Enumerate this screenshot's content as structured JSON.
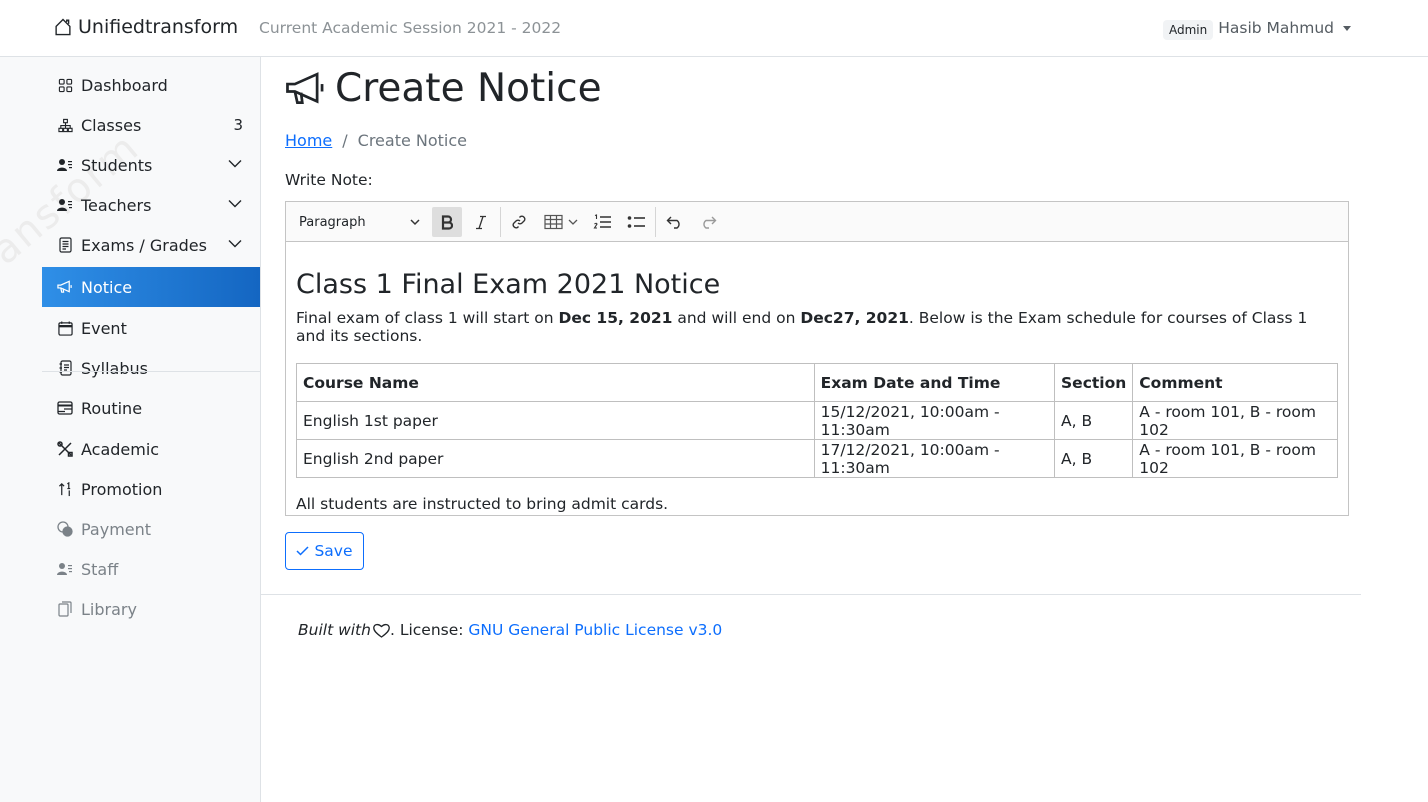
{
  "navbar": {
    "brand": "Unifiedtransform",
    "session": "Current Academic Session 2021 - 2022",
    "role_badge": "Admin",
    "user_name": "Hasib Mahmud"
  },
  "sidebar": {
    "watermark": "ransform",
    "items": [
      {
        "label": "Dashboard",
        "icon": "grid-icon"
      },
      {
        "label": "Classes",
        "icon": "diagram-icon",
        "count": "3"
      },
      {
        "label": "Students",
        "icon": "person-lines-icon"
      },
      {
        "label": "Teachers",
        "icon": "person-lines-icon"
      },
      {
        "label": "Exams / Grades",
        "icon": "file-text-icon"
      },
      {
        "label": "Notice",
        "icon": "megaphone-icon"
      },
      {
        "label": "Event",
        "icon": "calendar-icon"
      },
      {
        "label": "Syllabus",
        "icon": "journal-text-icon"
      },
      {
        "label": "Routine",
        "icon": "calendar-range-icon"
      },
      {
        "label": "Academic",
        "icon": "tools-icon"
      },
      {
        "label": "Promotion",
        "icon": "sort-numeric-icon"
      },
      {
        "label": "Payment",
        "icon": "coins-icon"
      },
      {
        "label": "Staff",
        "icon": "person-lines-icon"
      },
      {
        "label": "Library",
        "icon": "journals-icon"
      }
    ]
  },
  "page": {
    "title": "Create Notice",
    "breadcrumb_home": "Home",
    "breadcrumb_separator": "/",
    "breadcrumb_current": "Create Notice",
    "write_label": "Write Note:"
  },
  "editor": {
    "paragraph_select": "Paragraph",
    "notice": {
      "title": "Class 1 Final Exam 2021 Notice",
      "para_1": "Final exam of class 1 will start on ",
      "start_date": "Dec 15, 2021",
      "para_2": " and will end on ",
      "end_date": "Dec27, 2021",
      "para_3": ". Below is the Exam schedule for courses of Class 1 and its sections.",
      "table": {
        "headers": [
          "Course Name",
          "Exam Date and Time",
          "Section",
          "Comment"
        ],
        "rows": [
          [
            "English 1st paper",
            "15/12/2021, 10:00am - 11:30am",
            "A, B",
            "A - room 101, B - room 102"
          ],
          [
            "English 2nd paper",
            "17/12/2021, 10:00am - 11:30am",
            "A, B",
            "A - room 101, B - room 102"
          ]
        ]
      },
      "closing": "All students are instructed to bring admit cards."
    }
  },
  "save_label": "Save",
  "footer": {
    "built_with": "Built with",
    "license_prefix": ". License: ",
    "license_link": "GNU General Public License v3.0"
  },
  "colors": {
    "accent": "#0d6efd",
    "active_nav_start": "#2f8fe7",
    "active_nav_end": "#1466c2"
  }
}
